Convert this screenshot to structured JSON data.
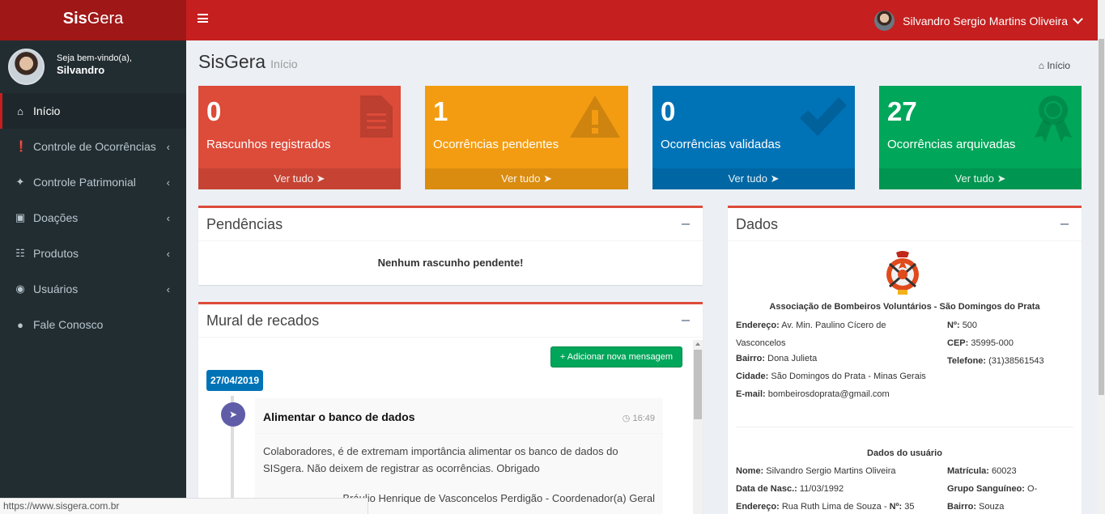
{
  "app": {
    "logo_bold": "Sis",
    "logo_rest": "Gera"
  },
  "topbar": {
    "user_name": "Silvandro Sergio Martins Oliveira"
  },
  "sidebar": {
    "welcome": "Seja bem-vindo(a),",
    "user": "Silvandro",
    "items": [
      {
        "label": "Início",
        "icon": "home-icon"
      },
      {
        "label": "Controle de Ocorrências",
        "icon": "exclamation-circle-icon"
      },
      {
        "label": "Controle Patrimonial",
        "icon": "tags-icon"
      },
      {
        "label": "Doações",
        "icon": "money-icon"
      },
      {
        "label": "Produtos",
        "icon": "cart-icon"
      },
      {
        "label": "Usuários",
        "icon": "user-circle-icon"
      },
      {
        "label": "Fale Conosco",
        "icon": "comment-icon"
      }
    ]
  },
  "header": {
    "title": "SisGera",
    "subtitle": "Início",
    "breadcrumb": "Início"
  },
  "stats": [
    {
      "value": "0",
      "label": "Rascunhos registrados",
      "link": "Ver tudo",
      "color": "#dd4b39"
    },
    {
      "value": "1",
      "label": "Ocorrências pendentes",
      "link": "Ver tudo",
      "color": "#f39c12"
    },
    {
      "value": "0",
      "label": "Ocorrências validadas",
      "link": "Ver tudo",
      "color": "#0073b7"
    },
    {
      "value": "27",
      "label": "Ocorrências arquivadas",
      "link": "Ver tudo",
      "color": "#00a65a"
    }
  ],
  "pendencias": {
    "title": "Pendências",
    "message": "Nenhum rascunho pendente!"
  },
  "mural": {
    "title": "Mural de recados",
    "add_button": "+ Adicionar nova mensagem",
    "date": "27/04/2019",
    "post_title": "Alimentar o banco de dados",
    "time": "16:49",
    "text": "Colaboradores, é de extremam importância alimentar os banco de dados do SISgera. Não deixem de registrar as ocorrências. Obrigado",
    "signature": "Bráulio Henrique de Vasconcelos Perdigão - Coordenador(a) Geral"
  },
  "dados": {
    "title": "Dados",
    "org": "Associação de Bombeiros Voluntários - São Domingos do Prata",
    "endereco_label": "Endereço:",
    "endereco": "Av. Min. Paulino Cícero de",
    "endereco_cont": "Vasconcelos",
    "bairro_label": "Bairro:",
    "bairro": "Dona Julieta",
    "cidade_label": "Cidade:",
    "cidade": "São Domingos do Prata - Minas Gerais",
    "email_label": "E-mail:",
    "email": "bombeirosdoprata@gmail.com",
    "numero_label": "Nº:",
    "numero": "500",
    "cep_label": "CEP:",
    "cep": "35995-000",
    "telefone_label": "Telefone:",
    "telefone": "(31)38561543",
    "user_section": "Dados do usuário",
    "nome_label": "Nome:",
    "nome": "Silvandro Sergio Martins Oliveira",
    "nasc_label": "Data de Nasc.:",
    "nasc": "11/03/1992",
    "uend_label": "Endereço:",
    "uend": "Rua Ruth Lima de Souza",
    "unum_label": "Nº:",
    "unum": "35",
    "matricula_label": "Matrícula:",
    "matricula": "60023",
    "sangue_label": "Grupo Sanguíneo:",
    "sangue": "O-",
    "ubairro_label": "Bairro:",
    "ubairro": "Souza"
  },
  "status_url": "https://www.sisgera.com.br"
}
